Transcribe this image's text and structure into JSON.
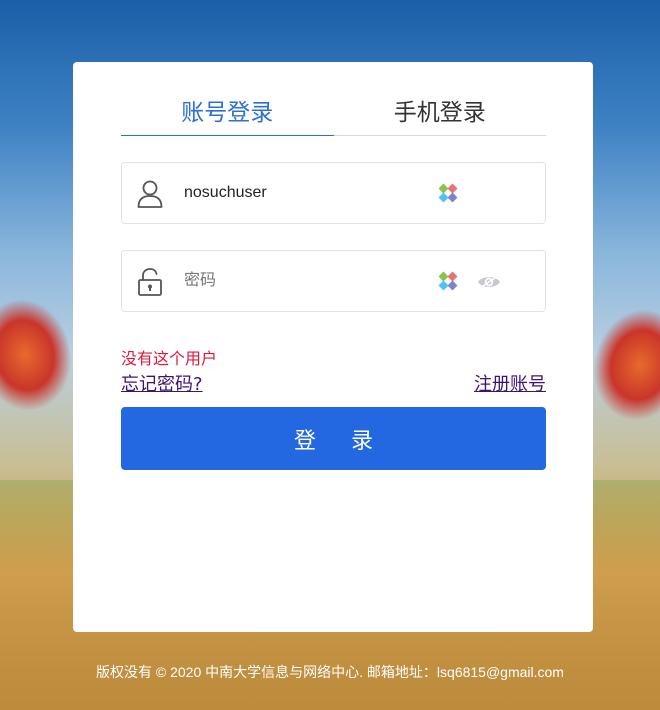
{
  "tabs": [
    {
      "label": "账号登录",
      "active": true
    },
    {
      "label": "手机登录",
      "active": false
    }
  ],
  "username_field": {
    "value": "nosuchuser",
    "placeholder": "",
    "icon": "user-icon"
  },
  "password_field": {
    "value": "",
    "placeholder": "密码",
    "icon": "lock-icon"
  },
  "error_message": "没有这个用户",
  "forgot_link": "忘记密码?",
  "register_link": "注册账号",
  "login_button": "登 录",
  "footer": "版权没有 © 2020 中南大学信息与网络中心. 邮箱地址：lsq6815@gmail.com",
  "colors": {
    "accent": "#2d6fd6",
    "button": "#2368e0",
    "error": "#e0193b",
    "link": "#3b1470"
  }
}
